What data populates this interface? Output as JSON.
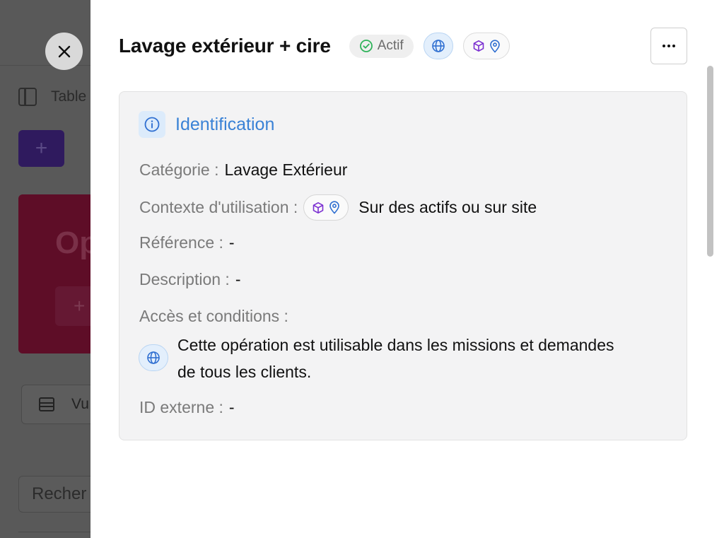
{
  "background": {
    "table_label": "Table",
    "add_symbol": "+",
    "card_title": "Op",
    "card_add_symbol": "+",
    "view_label": "Vu",
    "search_placeholder": "Recher"
  },
  "panel": {
    "title": "Lavage extérieur + cire",
    "status": "Actif",
    "more_label": "More options"
  },
  "identification": {
    "section_title": "Identification",
    "category_label": "Catégorie :",
    "category_value": "Lavage Extérieur",
    "context_label": "Contexte d'utilisation :",
    "context_value": "Sur des actifs ou sur site",
    "reference_label": "Référence :",
    "reference_value": "-",
    "description_label": "Description :",
    "description_value": "-",
    "access_label": "Accès et conditions :",
    "access_value": "Cette opération est utilisable dans les missions et demandes de tous les clients.",
    "external_id_label": "ID externe :",
    "external_id_value": "-"
  },
  "colors": {
    "accent_blue": "#3a82d6",
    "status_green": "#2fb35a",
    "cube_purple": "#7b2fd1",
    "pin_blue": "#2f6fd1"
  },
  "icons": [
    "close-icon",
    "sidebar-icon",
    "check-circle-icon",
    "globe-icon",
    "cube-icon",
    "map-pin-icon",
    "more-icon",
    "info-icon",
    "table-icon"
  ]
}
